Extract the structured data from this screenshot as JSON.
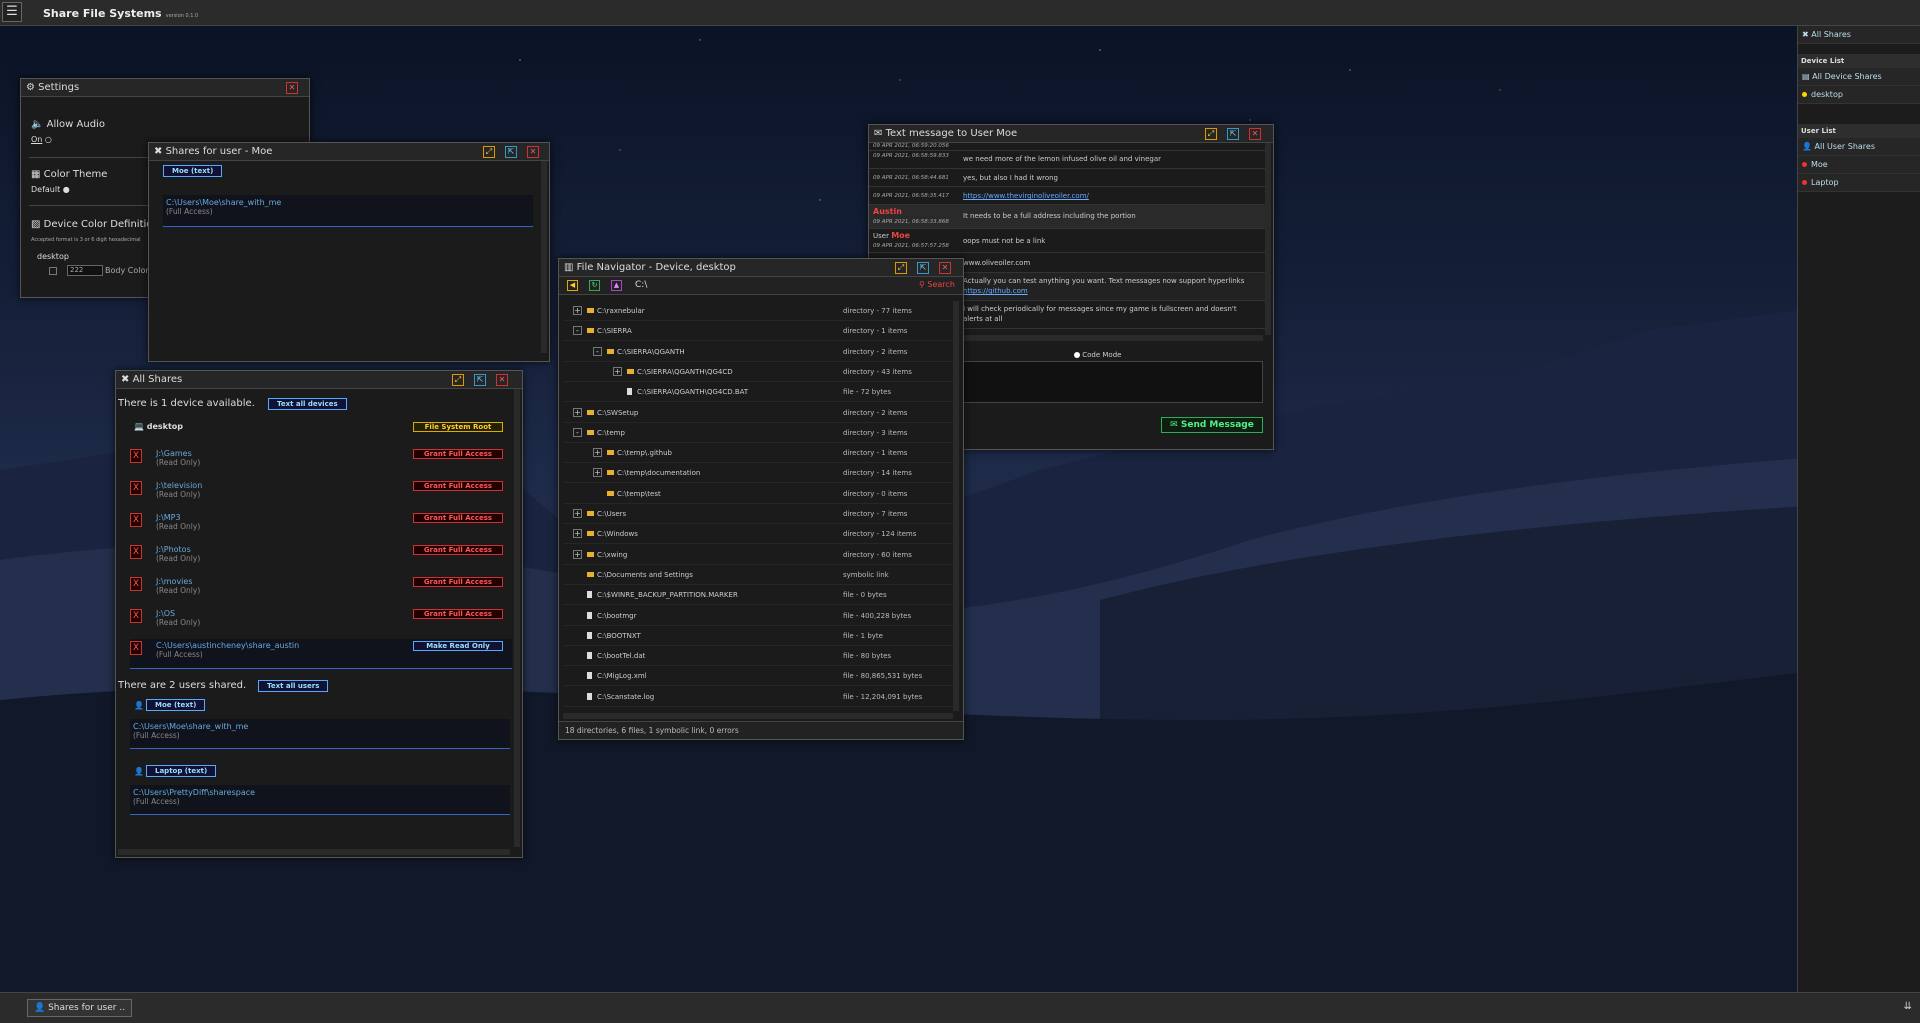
{
  "app": {
    "title": "Share File Systems",
    "version": "version 0.1.0",
    "menu_icon": "☰"
  },
  "sidebar": {
    "all_shares": "All Shares",
    "device_list_heading": "Device List",
    "all_device_shares": "All Device Shares",
    "devices": [
      {
        "name": "desktop",
        "color": "#ffd400"
      }
    ],
    "user_list_heading": "User List",
    "all_user_shares": "All User Shares",
    "users": [
      {
        "name": "Moe",
        "color": "#e33"
      },
      {
        "name": "Laptop",
        "color": "#e33"
      }
    ]
  },
  "taskbar": {
    "item": "Shares for user ..",
    "arrow": "⇊"
  },
  "settings": {
    "title": "Settings",
    "allow_audio": "Allow Audio",
    "on_label": "On",
    "color_theme": "Color Theme",
    "default_label": "Default",
    "device_color": "Device Color Definitions",
    "accepted_format": "Accepted format is 3 or 6 digit hexadecimal",
    "device": "desktop",
    "color_value": "222",
    "body_color": "Body Color"
  },
  "shares_moe": {
    "title": "Shares for user - Moe",
    "user_button": "Moe (text)",
    "path": "C:\\Users\\Moe\\share_with_me",
    "access": "(Full Access)"
  },
  "all_shares": {
    "title": "All Shares",
    "device_count_text": "There is 1 device available.",
    "text_all_devices": "Text all devices",
    "device_name": "desktop",
    "fs_root_button": "File System Root",
    "shares": [
      {
        "path": "J:\\Games",
        "access": "(Read Only)",
        "action": "Grant Full Access"
      },
      {
        "path": "J:\\television",
        "access": "(Read Only)",
        "action": "Grant Full Access"
      },
      {
        "path": "J:\\MP3",
        "access": "(Read Only)",
        "action": "Grant Full Access"
      },
      {
        "path": "J:\\Photos",
        "access": "(Read Only)",
        "action": "Grant Full Access"
      },
      {
        "path": "J:\\movies",
        "access": "(Read Only)",
        "action": "Grant Full Access"
      },
      {
        "path": "J:\\OS",
        "access": "(Read Only)",
        "action": "Grant Full Access"
      },
      {
        "path": "C:\\Users\\austincheney\\share_austin",
        "access": "(Full Access)",
        "action": "Make Read Only"
      }
    ],
    "users_shared_text": "There are 2 users shared.",
    "text_all_users": "Text all users",
    "users": [
      {
        "button": "Moe (text)",
        "path": "C:\\Users\\Moe\\share_with_me",
        "access": "(Full Access)"
      },
      {
        "button": "Laptop (text)",
        "path": "C:\\Users\\PrettyDiff\\sharespace",
        "access": "(Full Access)"
      }
    ]
  },
  "file_nav": {
    "title": "File Navigator - Device, desktop",
    "address": "C:\\",
    "search_label": "Search",
    "status": "18 directories, 6 files, 1 symbolic link, 0 errors",
    "rows": [
      {
        "exp": "+",
        "name": "C:\\raxnebular",
        "info": "directory - 77 items",
        "icon": "folder",
        "level": 0
      },
      {
        "exp": "-",
        "name": "C:\\SIERRA",
        "info": "directory - 1 items",
        "icon": "folder",
        "level": 0
      },
      {
        "exp": "-",
        "name": "C:\\SIERRA\\QGANTH",
        "info": "directory - 2 items",
        "icon": "folder",
        "level": 1
      },
      {
        "exp": "+",
        "name": "C:\\SIERRA\\QGANTH\\QG4CD",
        "info": "directory - 43 items",
        "icon": "folder",
        "level": 2
      },
      {
        "exp": "",
        "name": "C:\\SIERRA\\QGANTH\\QG4CD.BAT",
        "info": "file - 72 bytes",
        "icon": "file",
        "level": 2
      },
      {
        "exp": "+",
        "name": "C:\\SWSetup",
        "info": "directory - 2 items",
        "icon": "folder",
        "level": 0
      },
      {
        "exp": "-",
        "name": "C:\\temp",
        "info": "directory - 3 items",
        "icon": "folder",
        "level": 0
      },
      {
        "exp": "+",
        "name": "C:\\temp\\.github",
        "info": "directory - 1 items",
        "icon": "folder",
        "level": 1
      },
      {
        "exp": "+",
        "name": "C:\\temp\\documentation",
        "info": "directory - 14 items",
        "icon": "folder",
        "level": 1
      },
      {
        "exp": "",
        "name": "C:\\temp\\test",
        "info": "directory - 0 items",
        "icon": "folder",
        "level": 1
      },
      {
        "exp": "+",
        "name": "C:\\Users",
        "info": "directory - 7 items",
        "icon": "folder",
        "level": 0
      },
      {
        "exp": "+",
        "name": "C:\\Windows",
        "info": "directory - 124 items",
        "icon": "folder",
        "level": 0
      },
      {
        "exp": "+",
        "name": "C:\\xwing",
        "info": "directory - 60 items",
        "icon": "folder",
        "level": 0
      },
      {
        "exp": "",
        "name": "C:\\Documents and Settings",
        "info": "symbolic link",
        "icon": "folder",
        "level": 0
      },
      {
        "exp": "",
        "name": "C:\\$WINRE_BACKUP_PARTITION.MARKER",
        "info": "file - 0 bytes",
        "icon": "file",
        "level": 0
      },
      {
        "exp": "",
        "name": "C:\\bootmgr",
        "info": "file - 400,228 bytes",
        "icon": "file",
        "level": 0
      },
      {
        "exp": "",
        "name": "C:\\BOOTNXT",
        "info": "file - 1 byte",
        "icon": "file",
        "level": 0
      },
      {
        "exp": "",
        "name": "C:\\bootTel.dat",
        "info": "file - 80 bytes",
        "icon": "file",
        "level": 0
      },
      {
        "exp": "",
        "name": "C:\\MigLog.xml",
        "info": "file - 80,865,531 bytes",
        "icon": "file",
        "level": 0
      },
      {
        "exp": "",
        "name": "C:\\Scanstate.log",
        "info": "file - 12,204,091 bytes",
        "icon": "file",
        "level": 0
      }
    ]
  },
  "messages": {
    "title": "Text message to User Moe",
    "code_mode": "Code Mode",
    "send": "Send Message",
    "rows": [
      {
        "time": "09 APR 2021, 06:59:20.056",
        "text": ""
      },
      {
        "time": "09 APR 2021, 06:58:59.833",
        "text": "we need more of the lemon infused olive oil and vinegar"
      },
      {
        "time": "09 APR 2021, 06:58:44.681",
        "text": "yes, but also I had it wrong"
      },
      {
        "time": "09 APR 2021, 06:58:35.417",
        "text": "https://www.thevirginoliveoiler.com/",
        "link": true
      },
      {
        "time": "09 APR 2021, 06:58:33.868",
        "text": "It needs to be a full address including the portion",
        "author": "Austin"
      },
      {
        "time": "09 APR 2021, 06:57:57.258",
        "text": "oops must not be a link",
        "author_prefix": "User",
        "author": "Moe"
      },
      {
        "time": "",
        "text": "www.oliveoiler.com"
      },
      {
        "time": "",
        "text": "Actually you can test anything you want. Text messages now support hyperlinks",
        "text2": "https://github.com"
      },
      {
        "time": "",
        "text": "I will check periodically for messages since my game is fullscreen and doesn't",
        "text2": "alerts at all"
      }
    ]
  }
}
